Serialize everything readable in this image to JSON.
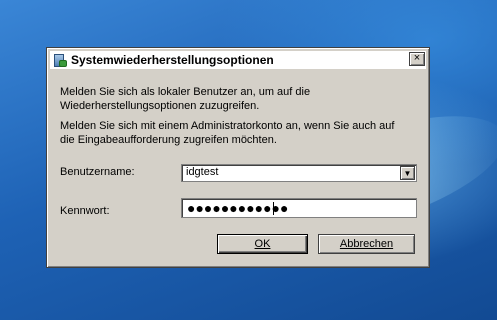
{
  "dialog": {
    "title": "Systemwiederherstellungsoptionen",
    "close_glyph": "×",
    "message_1": "Melden Sie sich als lokaler Benutzer an, um auf die Wiederherstellungsoptionen zuzugreifen.",
    "message_2": "Melden Sie sich mit einem Administratorkonto  an, wenn Sie auch auf die Eingabeaufforderung zugreifen möchten.",
    "username_label": "Benutzername:",
    "username_value": "idgtest",
    "password_label": "Kennwort:",
    "password_masked": "●●●●●●●●●●●●",
    "ok_label": "OK",
    "cancel_label": "Abbrechen"
  },
  "colors": {
    "dialog_face": "#d4d0c8",
    "desktop": "#1f5fa8"
  }
}
